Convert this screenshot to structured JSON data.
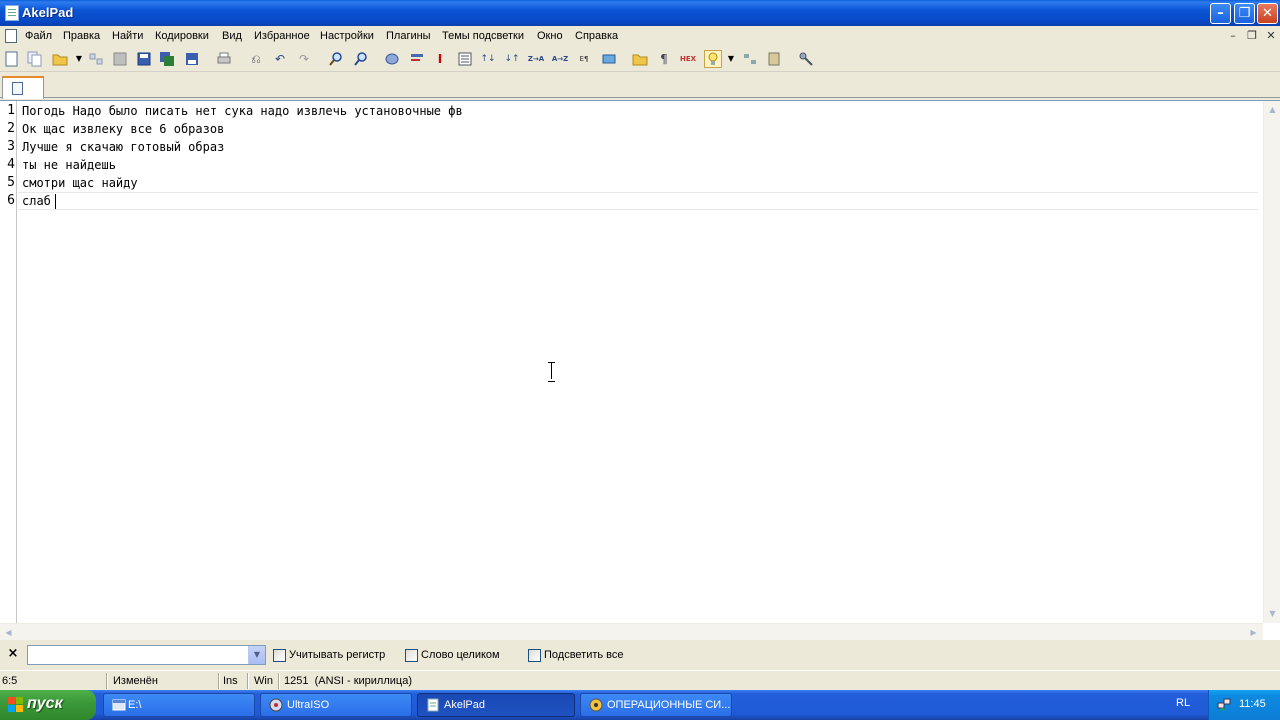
{
  "window": {
    "title": "AkelPad"
  },
  "menu": {
    "items": [
      "Файл",
      "Правка",
      "Найти",
      "Кодировки",
      "Вид",
      "Избранное",
      "Настройки",
      "Плагины",
      "Темы подсветки",
      "Окно",
      "Справка"
    ]
  },
  "toolbar": {
    "icons": [
      "new-file-icon",
      "copy-icon",
      "open-icon",
      "reopen-icon",
      "save-icon",
      "save-all-icon",
      "save-as-icon",
      "print-icon",
      "undo-icon",
      "redo-icon",
      "find-icon",
      "replace-icon",
      "goto-icon",
      "insert-icon",
      "list-icon",
      "sort-asc-icon",
      "sort-desc-icon",
      "za-icon",
      "az-icon",
      "case-icon",
      "wrap-icon",
      "folder-icon",
      "pilcrow-icon",
      "hex-icon",
      "highlight-icon",
      "split-icon",
      "clipboard-icon",
      "tool-icon"
    ],
    "hex_label": "HEX"
  },
  "tabs": [
    {
      "label": ""
    }
  ],
  "editor": {
    "lines": [
      "Погодь Надо было писать нет сука надо извлечь установочные фв",
      "Ок щас извлеку все 6 образов",
      "Лучше я скачаю готовый образ",
      "ты не найдешь",
      "смотри щас найду",
      "слаб"
    ],
    "line_numbers": [
      "1",
      "2",
      "3",
      "4",
      "5",
      "6"
    ],
    "current_line": 6
  },
  "findbar": {
    "close_label": "×",
    "search_value": "",
    "checkboxes": [
      {
        "label": "Учитывать регистр",
        "checked": false
      },
      {
        "label": "Слово целиком",
        "checked": false
      },
      {
        "label": "Подсветить все",
        "checked": false
      }
    ]
  },
  "status": {
    "position": "6:5",
    "modified": "Изменён",
    "insert_mode": "Ins",
    "newline": "Win",
    "codepage": "1251  (ANSI - кириллица)"
  },
  "taskbar": {
    "start_label": "пуск",
    "tasks": [
      {
        "label": "E:\\",
        "active": false
      },
      {
        "label": "UltraISO",
        "active": false
      },
      {
        "label": "AkelPad",
        "active": true
      },
      {
        "label": "ОПЕРАЦИОННЫЕ СИ...",
        "active": false
      }
    ],
    "language": "RL",
    "clock": "11:45"
  },
  "colors": {
    "titlebar": "#0a54d4",
    "taskbar": "#245edb",
    "start_button": "#3c9a3a",
    "tray": "#0f8ae1",
    "window_bg": "#ece9d8"
  }
}
